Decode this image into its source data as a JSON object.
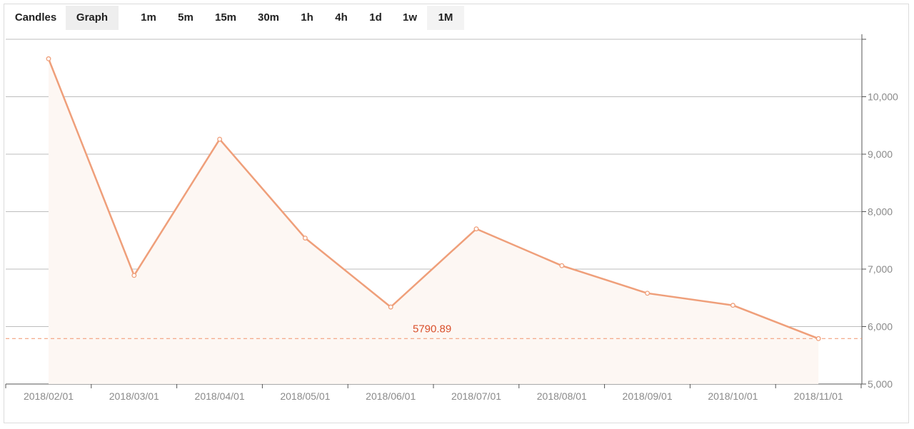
{
  "view_tabs": [
    {
      "label": "Candles",
      "active": false
    },
    {
      "label": "Graph",
      "active": true
    }
  ],
  "interval_tabs": [
    {
      "label": "1m",
      "active": false
    },
    {
      "label": "5m",
      "active": false
    },
    {
      "label": "15m",
      "active": false
    },
    {
      "label": "30m",
      "active": false
    },
    {
      "label": "1h",
      "active": false
    },
    {
      "label": "4h",
      "active": false
    },
    {
      "label": "1d",
      "active": false
    },
    {
      "label": "1w",
      "active": false
    },
    {
      "label": "1M",
      "active": true
    }
  ],
  "colors": {
    "line": "#ef9f7a",
    "fill": "#fdf7f3",
    "price_line": "#f2a07d",
    "price_text": "#d9502c",
    "grid": "#bdbdbd"
  },
  "chart_data": {
    "type": "area",
    "x": [
      "2018/02/01",
      "2018/03/01",
      "2018/04/01",
      "2018/05/01",
      "2018/06/01",
      "2018/07/01",
      "2018/08/01",
      "2018/09/01",
      "2018/10/01",
      "2018/11/01"
    ],
    "values": [
      10660,
      6890,
      9260,
      7540,
      6340,
      7700,
      7060,
      6580,
      6370,
      5790.89
    ],
    "ylim": [
      5000,
      11000
    ],
    "y_ticks": [
      5000,
      6000,
      7000,
      8000,
      9000,
      10000
    ],
    "y_tick_labels": [
      "5,000",
      "6,000",
      "7,000",
      "8,000",
      "9,000",
      "10,000"
    ],
    "current_price": 5790.89,
    "current_price_label": "5790.89",
    "grid": true,
    "y_axis_side": "right"
  }
}
